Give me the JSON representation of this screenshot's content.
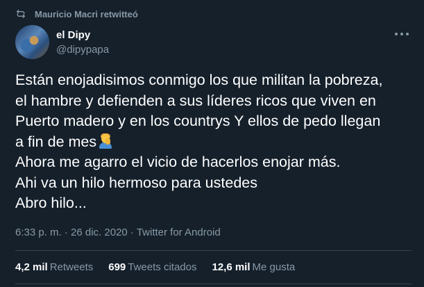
{
  "retweet_context": {
    "icon": "retweet-icon",
    "text": "Mauricio Macri retwitteó"
  },
  "author": {
    "display_name": "el Dipy",
    "handle": "@dipypapa"
  },
  "tweet": {
    "lines": [
      "Están enojadisimos conmigo los que militan la pobreza,",
      "el hambre y defienden a sus líderes ricos que viven en",
      "Puerto madero y en los countrys  Y ellos de pedo llegan",
      "a fin de mes",
      "Ahora me agarro el vicio de hacerlos enojar más.",
      "Ahi va un hilo hermoso para ustedes",
      "Abro hilo..."
    ],
    "emoji": "face-palm-emoji"
  },
  "meta": {
    "text": "6:33 p. m. · 26 dic. 2020 · Twitter for Android"
  },
  "stats": [
    {
      "value": "4,2 mil",
      "label": "Retweets"
    },
    {
      "value": "699",
      "label": "Tweets citados"
    },
    {
      "value": "12,6 mil",
      "label": "Me gusta"
    }
  ],
  "colors": {
    "background": "#15202b",
    "primary_text": "#ffffff",
    "secondary_text": "#8899a6",
    "divider": "#38444d"
  }
}
